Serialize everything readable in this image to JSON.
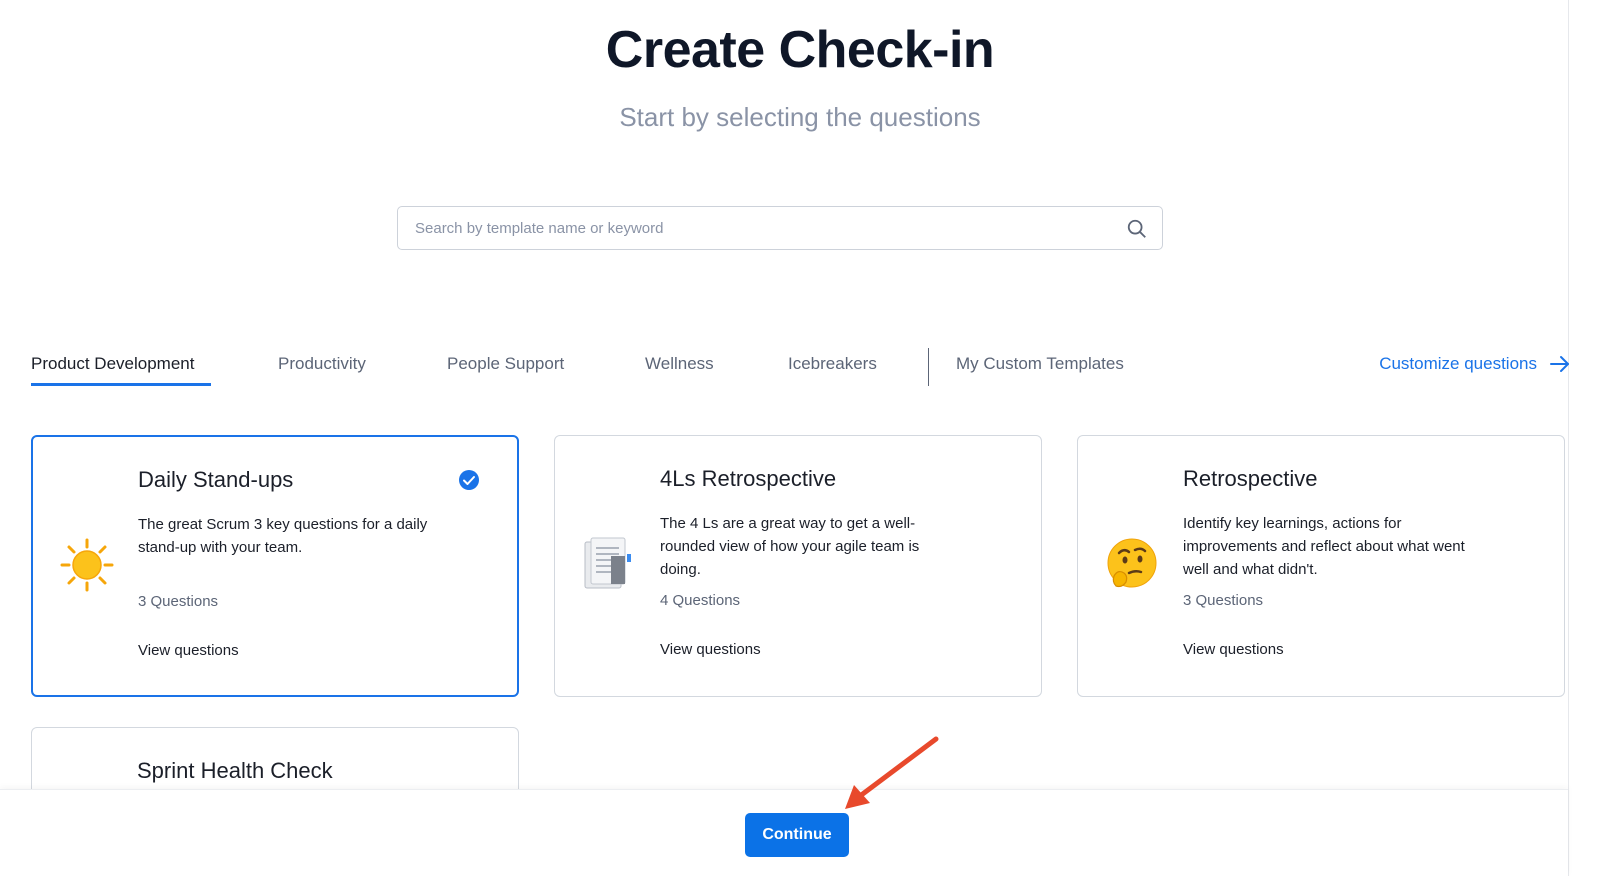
{
  "header": {
    "title": "Create Check-in",
    "subtitle": "Start by selecting the questions"
  },
  "search": {
    "placeholder": "Search by template name or keyword",
    "icon": "search-icon"
  },
  "tabs": [
    {
      "label": "Product Development",
      "active": true
    },
    {
      "label": "Productivity",
      "active": false
    },
    {
      "label": "People Support",
      "active": false
    },
    {
      "label": "Wellness",
      "active": false
    },
    {
      "label": "Icebreakers",
      "active": false
    },
    {
      "label": "My Custom Templates",
      "active": false
    }
  ],
  "customize": {
    "label": "Customize questions",
    "icon": "arrow-right-icon"
  },
  "cards": [
    {
      "title": "Daily Stand-ups",
      "description": "The great Scrum 3 key questions for a daily stand-up with your team.",
      "count": "3 Questions",
      "view_label": "View questions",
      "icon": "sun-icon",
      "selected": true
    },
    {
      "title": "4Ls Retrospective",
      "description": "The 4 Ls are a great way to get a well-rounded view of how your agile team is doing.",
      "count": "4 Questions",
      "view_label": "View questions",
      "icon": "document-icon",
      "selected": false
    },
    {
      "title": "Retrospective",
      "description": "Identify key learnings, actions for improvements and reflect about what went well and what didn't.",
      "count": "3 Questions",
      "view_label": "View questions",
      "icon": "thinking-face-icon",
      "selected": false
    },
    {
      "title": "Sprint Health Check"
    }
  ],
  "footer": {
    "continue_label": "Continue"
  },
  "colors": {
    "accent": "#1a73e8",
    "button": "#0b72e7",
    "annotation_arrow": "#e8492c"
  }
}
